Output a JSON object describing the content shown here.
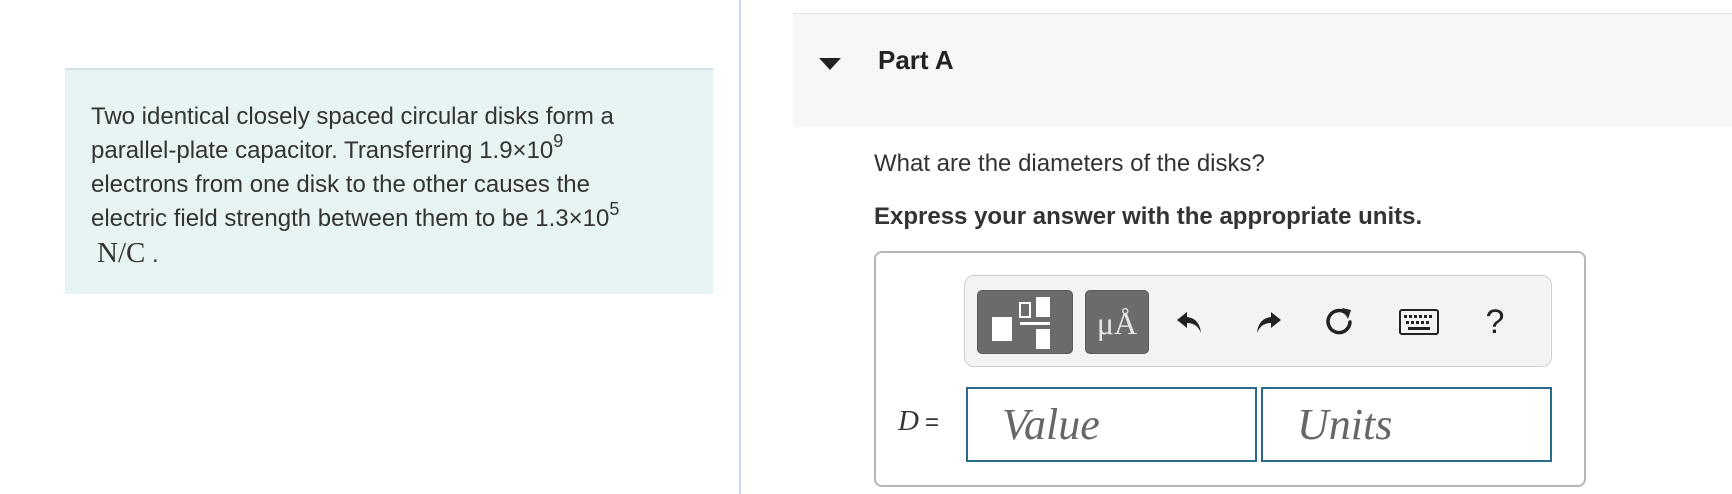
{
  "problem": {
    "text_line1": "Two identical closely spaced circular disks form a",
    "text_line2_prefix": "parallel-plate capacitor. Transferring 1.9×10",
    "exp1": "9",
    "text_line3": "electrons from one disk to the other causes the",
    "text_line4_prefix": "electric field strength between them to be 1.3×10",
    "exp2": "5",
    "unit": "N/C",
    "period": "."
  },
  "part": {
    "title": "Part A",
    "question": "What are the diameters of the disks?",
    "instruction": "Express your answer with the appropriate units."
  },
  "toolbar": {
    "units_label": "μÅ",
    "help_label": "?",
    "icons": [
      "templates-icon",
      "units-icon",
      "undo-icon",
      "redo-icon",
      "reset-icon",
      "keyboard-icon",
      "help-icon"
    ]
  },
  "answer": {
    "variable": "D",
    "equals": "=",
    "value_placeholder": "Value",
    "units_placeholder": "Units"
  },
  "colors": {
    "problem_bg": "#e8f4f4",
    "part_header_bg": "#f7f7f7",
    "input_border": "#2a6a8c",
    "toolbar_button": "#6b6b6b"
  }
}
